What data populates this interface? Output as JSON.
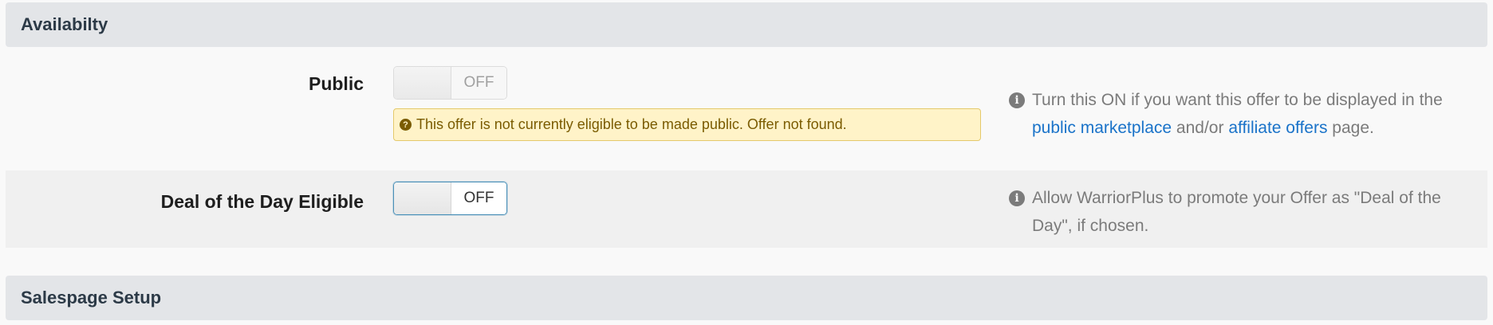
{
  "sections": {
    "availability": "Availabilty",
    "salespage": "Salespage Setup"
  },
  "public": {
    "label": "Public",
    "toggle_state": "OFF",
    "warning": "This offer is not currently eligible to be made public. Offer not found.",
    "help": {
      "prefix": "Turn this ON if you want this offer to be displayed in the ",
      "link1": "public marketplace",
      "middle": " and/or ",
      "link2": "affiliate offers",
      "suffix": " page."
    }
  },
  "deal": {
    "label": "Deal of the Day Eligible",
    "toggle_state": "OFF",
    "help": "Allow WarriorPlus to promote your Offer as \"Deal of the Day\", if chosen."
  },
  "icons": {
    "info": "info-circle-icon",
    "question": "question-circle-icon"
  },
  "colors": {
    "header_bg": "#e3e5e8",
    "warning_bg": "#fff3c8",
    "link": "#1a73c9",
    "focus_border": "#4a90b8"
  }
}
